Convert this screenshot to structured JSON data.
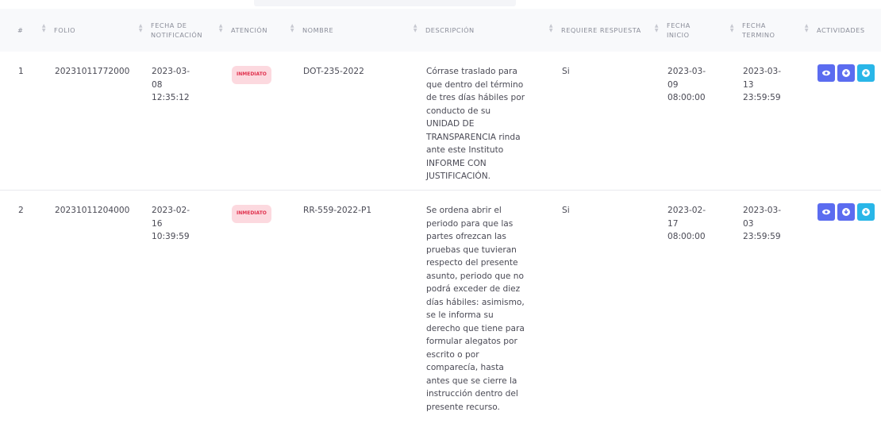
{
  "table": {
    "headers": {
      "num": "#",
      "folio": "FOLIO",
      "fecha_notificacion": "FECHA DE NOTIFICACIÓN",
      "atencion": "ATENCIÓN",
      "nombre": "NOMBRE",
      "descripcion": "DESCRIPCIÓN",
      "requiere_respuesta": "REQUIERE RESPUESTA",
      "fecha_inicio": "FECHA INICIO",
      "fecha_termino": "FECHA TERMINO",
      "actividades": "ACTIVIDADES"
    },
    "rows": [
      {
        "num": "1",
        "folio": "20231011772000",
        "fecha_notificacion": "2023-03-08 12:35:12",
        "atencion": "INMEDIATO",
        "nombre": "DOT-235-2022",
        "descripcion": "Córrase traslado para que dentro del término de tres días hábiles por conducto de su UNIDAD DE TRANSPARENCIA rinda ante este Instituto INFORME CON JUSTIFICACIÓN.",
        "requiere_respuesta": "Si",
        "fecha_inicio": "2023-03-09 08:00:00",
        "fecha_termino": "2023-03-13 23:59:59"
      },
      {
        "num": "2",
        "folio": "20231011204000",
        "fecha_notificacion": "2023-02-16 10:39:59",
        "atencion": "INMEDIATO",
        "nombre": "RR-559-2022-P1",
        "descripcion": "Se ordena abrir el periodo para que las partes ofrezcan las pruebas que tuvieran respecto del presente asunto, periodo que no podrá exceder de diez días hábiles: asimismo, se le informa su derecho que tiene para formular alegatos por escrito o por comparecía, hasta antes que se cierre la instrucción dentro del presente recurso.",
        "requiere_respuesta": "Si",
        "fecha_inicio": "2023-02-17 08:00:00",
        "fecha_termino": "2023-03-03 23:59:59"
      }
    ],
    "action_icons": [
      "eye-icon",
      "download-icon",
      "download-icon"
    ],
    "colors": {
      "badge_bg": "#fcd9df",
      "badge_text": "#e0334f",
      "btn_primary": "#5b6cf0",
      "btn_info": "#29b6e8"
    }
  }
}
